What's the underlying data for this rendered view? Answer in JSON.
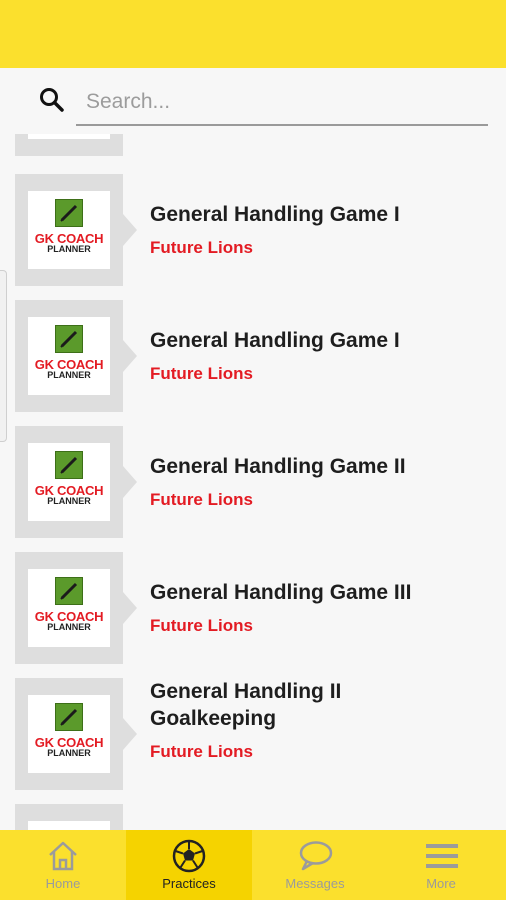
{
  "search": {
    "placeholder": "Search..."
  },
  "logo": {
    "line1": "GK COACH",
    "line2": "PLANNER"
  },
  "practices": [
    {
      "title": "General Handling Game I",
      "team": "Future Lions"
    },
    {
      "title": "General Handling Game I",
      "team": "Future Lions"
    },
    {
      "title": "General Handling Game II",
      "team": "Future Lions"
    },
    {
      "title": "General Handling Game III",
      "team": "Future Lions"
    },
    {
      "title": "General Handling II Goalkeeping",
      "team": "Future Lions"
    }
  ],
  "nav": [
    {
      "label": "Home",
      "icon": "home-icon",
      "active": false
    },
    {
      "label": "Practices",
      "icon": "soccer-ball-icon",
      "active": true
    },
    {
      "label": "Messages",
      "icon": "chat-bubble-icon",
      "active": false
    },
    {
      "label": "More",
      "icon": "hamburger-menu-icon",
      "active": false
    }
  ],
  "colors": {
    "brand_yellow": "#fbe02d",
    "accent_red": "#e31b23",
    "logo_green": "#5b9a2b"
  }
}
